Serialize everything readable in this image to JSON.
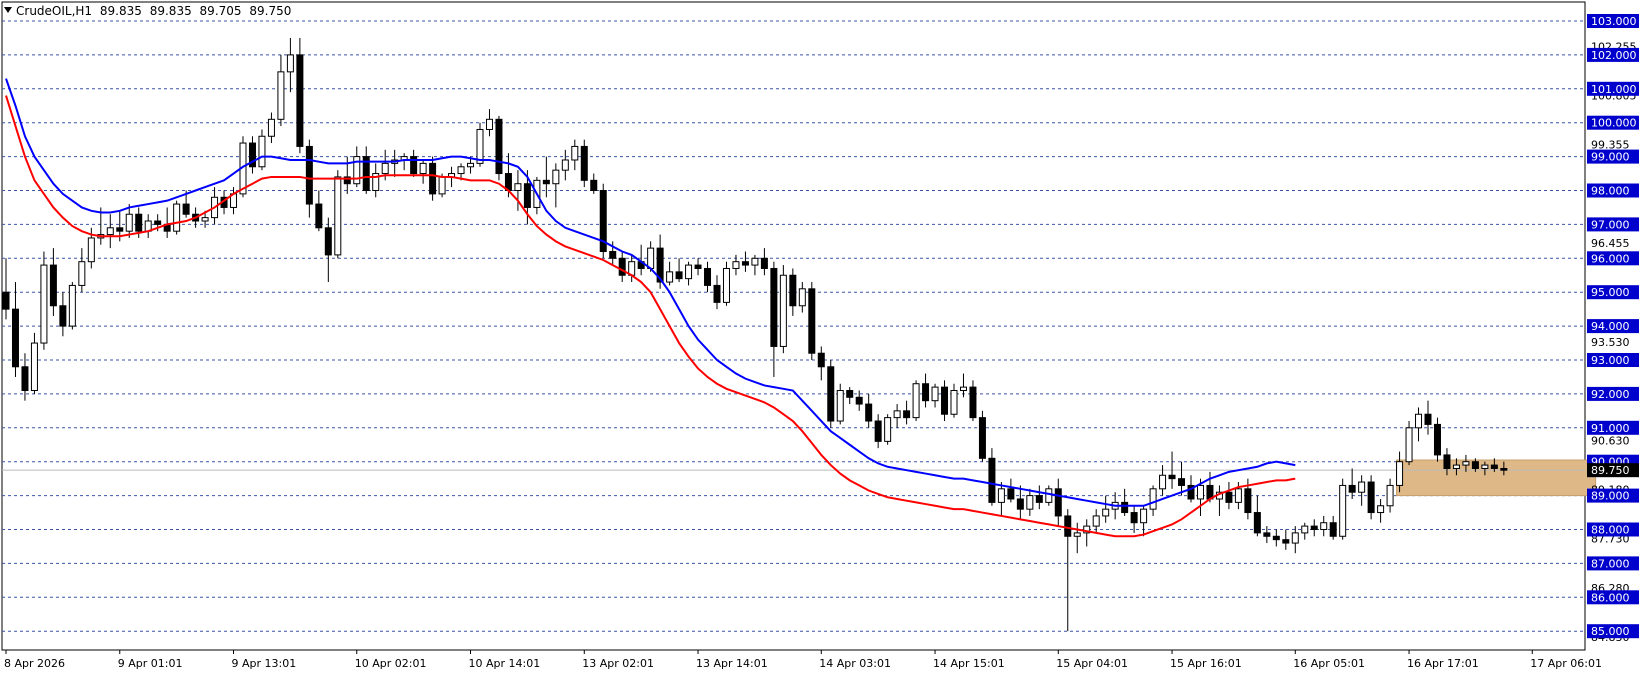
{
  "header": {
    "symbol": "CrudeOIL,H1",
    "open": "89.835",
    "high": "89.835",
    "low": "89.705",
    "close": "89.750"
  },
  "colors": {
    "background": "#ffffff",
    "grid": "#3b55a5",
    "bull_candle": "#ffffff",
    "bear_candle": "#000000",
    "ma_fast": "#0000ff",
    "ma_slow": "#ff0000",
    "zone": "#deb887",
    "highlight_label": "#0000cd",
    "current_price_label": "#000000"
  },
  "chart_data": {
    "type": "candlestick",
    "title": "CrudeOIL,H1",
    "ylim": [
      84.6,
      103.5
    ],
    "grid": true,
    "price_levels": [
      "103.000",
      "102.000",
      "101.000",
      "100.000",
      "99.000",
      "98.000",
      "97.000",
      "96.000",
      "95.000",
      "94.000",
      "93.000",
      "92.000",
      "91.000",
      "90.000",
      "89.000",
      "88.000",
      "87.000",
      "86.000",
      "85.000"
    ],
    "minor_labels": [
      {
        "value": 102.255,
        "text": "102.255"
      },
      {
        "value": 100.805,
        "text": "100.805"
      },
      {
        "value": 99.355,
        "text": "99.355"
      },
      {
        "value": 96.455,
        "text": "96.455"
      },
      {
        "value": 93.53,
        "text": "93.530"
      },
      {
        "value": 90.63,
        "text": "90.630"
      },
      {
        "value": 89.18,
        "text": "89.180"
      },
      {
        "value": 87.73,
        "text": "87.730"
      },
      {
        "value": 86.28,
        "text": "86.280"
      },
      {
        "value": 84.83,
        "text": "84.830"
      }
    ],
    "current_price": {
      "value": 89.75,
      "text": "89.750"
    },
    "x_labels": [
      {
        "index": 0,
        "text": "8 Apr 2026"
      },
      {
        "index": 12,
        "text": "9 Apr 01:01"
      },
      {
        "index": 24,
        "text": "9 Apr 13:01"
      },
      {
        "index": 37,
        "text": "10 Apr 02:01"
      },
      {
        "index": 49,
        "text": "10 Apr 14:01"
      },
      {
        "index": 61,
        "text": "13 Apr 02:01"
      },
      {
        "index": 73,
        "text": "13 Apr 14:01"
      },
      {
        "index": 86,
        "text": "14 Apr 03:01"
      },
      {
        "index": 98,
        "text": "14 Apr 15:01"
      },
      {
        "index": 111,
        "text": "15 Apr 04:01"
      },
      {
        "index": 123,
        "text": "15 Apr 16:01"
      },
      {
        "index": 136,
        "text": "16 Apr 05:01"
      },
      {
        "index": 148,
        "text": "16 Apr 17:01"
      },
      {
        "index": 161,
        "text": "17 Apr 06:01"
      }
    ],
    "zone": {
      "from_index": 147,
      "to_index": 168,
      "high": 90.05,
      "low": 89.0
    },
    "ohlc": [
      [
        95.0,
        96.0,
        94.2,
        94.5
      ],
      [
        94.5,
        95.3,
        92.5,
        92.8
      ],
      [
        92.8,
        93.2,
        91.8,
        92.1
      ],
      [
        92.1,
        93.8,
        92.0,
        93.5
      ],
      [
        93.5,
        96.2,
        93.3,
        95.8
      ],
      [
        95.8,
        96.3,
        94.3,
        94.6
      ],
      [
        94.6,
        95.0,
        93.7,
        94.0
      ],
      [
        94.0,
        95.3,
        93.9,
        95.2
      ],
      [
        95.2,
        96.3,
        95.0,
        95.9
      ],
      [
        95.9,
        96.9,
        95.7,
        96.6
      ],
      [
        96.6,
        97.5,
        96.4,
        96.7
      ],
      [
        96.7,
        97.3,
        96.3,
        96.9
      ],
      [
        96.9,
        97.4,
        96.5,
        96.8
      ],
      [
        96.8,
        97.6,
        96.6,
        97.3
      ],
      [
        97.3,
        97.5,
        96.6,
        96.8
      ],
      [
        96.8,
        97.3,
        96.6,
        97.1
      ],
      [
        97.1,
        97.3,
        96.8,
        97.0
      ],
      [
        97.0,
        97.5,
        96.6,
        96.8
      ],
      [
        96.8,
        97.7,
        96.7,
        97.6
      ],
      [
        97.6,
        98.0,
        97.2,
        97.3
      ],
      [
        97.3,
        97.5,
        96.9,
        97.1
      ],
      [
        97.1,
        97.4,
        96.9,
        97.2
      ],
      [
        97.2,
        98.1,
        97.0,
        97.8
      ],
      [
        97.8,
        98.0,
        97.3,
        97.5
      ],
      [
        97.5,
        98.1,
        97.3,
        97.9
      ],
      [
        97.9,
        99.6,
        97.8,
        99.4
      ],
      [
        99.4,
        99.6,
        98.5,
        98.7
      ],
      [
        98.7,
        99.8,
        98.6,
        99.6
      ],
      [
        99.6,
        100.3,
        99.4,
        100.1
      ],
      [
        100.1,
        102.0,
        99.9,
        101.5
      ],
      [
        101.5,
        102.5,
        100.9,
        102.0
      ],
      [
        102.0,
        102.5,
        99.1,
        99.3
      ],
      [
        99.3,
        99.5,
        97.2,
        97.6
      ],
      [
        97.6,
        98.0,
        96.8,
        96.9
      ],
      [
        96.9,
        97.2,
        95.3,
        96.1
      ],
      [
        96.1,
        98.6,
        96.0,
        98.4
      ],
      [
        98.4,
        99.0,
        97.9,
        98.2
      ],
      [
        98.2,
        99.3,
        98.1,
        99.0
      ],
      [
        99.0,
        99.3,
        97.9,
        98.0
      ],
      [
        98.0,
        98.8,
        97.8,
        98.5
      ],
      [
        98.5,
        99.2,
        98.3,
        98.8
      ],
      [
        98.8,
        99.2,
        98.4,
        98.9
      ],
      [
        98.9,
        99.1,
        98.6,
        99.0
      ],
      [
        99.0,
        99.2,
        98.4,
        98.5
      ],
      [
        98.5,
        98.9,
        98.2,
        98.8
      ],
      [
        98.8,
        99.0,
        97.7,
        97.9
      ],
      [
        97.9,
        98.5,
        97.8,
        98.4
      ],
      [
        98.4,
        98.7,
        98.1,
        98.5
      ],
      [
        98.5,
        98.8,
        98.3,
        98.7
      ],
      [
        98.7,
        99.0,
        98.5,
        98.8
      ],
      [
        98.8,
        100.0,
        98.7,
        99.8
      ],
      [
        99.8,
        100.4,
        99.6,
        100.1
      ],
      [
        100.1,
        100.2,
        98.3,
        98.5
      ],
      [
        98.5,
        99.1,
        97.8,
        98.0
      ],
      [
        98.0,
        98.6,
        97.4,
        98.2
      ],
      [
        98.2,
        98.6,
        97.0,
        97.5
      ],
      [
        97.5,
        98.4,
        97.3,
        98.3
      ],
      [
        98.3,
        99.0,
        97.8,
        98.2
      ],
      [
        98.2,
        98.8,
        97.5,
        98.6
      ],
      [
        98.6,
        99.2,
        98.3,
        98.9
      ],
      [
        98.9,
        99.5,
        98.6,
        99.3
      ],
      [
        99.3,
        99.5,
        98.1,
        98.3
      ],
      [
        98.3,
        98.5,
        97.9,
        98.0
      ],
      [
        98.0,
        98.2,
        96.0,
        96.2
      ],
      [
        96.2,
        96.5,
        95.8,
        96.0
      ],
      [
        96.0,
        96.2,
        95.3,
        95.5
      ],
      [
        95.5,
        96.1,
        95.3,
        95.9
      ],
      [
        95.9,
        96.4,
        95.5,
        95.7
      ],
      [
        95.7,
        96.5,
        95.6,
        96.3
      ],
      [
        96.3,
        96.7,
        95.1,
        95.3
      ],
      [
        95.3,
        95.9,
        95.2,
        95.6
      ],
      [
        95.6,
        96.0,
        95.3,
        95.4
      ],
      [
        95.4,
        95.9,
        95.2,
        95.8
      ],
      [
        95.8,
        96.0,
        95.5,
        95.7
      ],
      [
        95.7,
        95.9,
        95.0,
        95.2
      ],
      [
        95.2,
        95.5,
        94.5,
        94.7
      ],
      [
        94.7,
        95.9,
        94.6,
        95.7
      ],
      [
        95.7,
        96.1,
        95.5,
        95.9
      ],
      [
        95.9,
        96.2,
        95.6,
        95.8
      ],
      [
        95.8,
        96.1,
        95.5,
        96.0
      ],
      [
        96.0,
        96.3,
        95.5,
        95.7
      ],
      [
        95.7,
        95.9,
        92.5,
        93.4
      ],
      [
        93.4,
        95.8,
        93.2,
        95.5
      ],
      [
        95.5,
        95.7,
        94.3,
        94.6
      ],
      [
        94.6,
        95.3,
        94.4,
        95.1
      ],
      [
        95.1,
        95.3,
        93.0,
        93.2
      ],
      [
        93.2,
        93.4,
        92.4,
        92.8
      ],
      [
        92.8,
        93.0,
        91.0,
        91.2
      ],
      [
        91.2,
        92.3,
        91.1,
        92.1
      ],
      [
        92.1,
        92.2,
        91.7,
        91.9
      ],
      [
        91.9,
        92.1,
        91.5,
        91.7
      ],
      [
        91.7,
        92.0,
        91.0,
        91.2
      ],
      [
        91.2,
        91.4,
        90.4,
        90.6
      ],
      [
        90.6,
        91.4,
        90.5,
        91.3
      ],
      [
        91.3,
        91.7,
        91.0,
        91.5
      ],
      [
        91.5,
        91.8,
        91.1,
        91.3
      ],
      [
        91.3,
        92.4,
        91.2,
        92.3
      ],
      [
        92.3,
        92.6,
        91.6,
        91.8
      ],
      [
        91.8,
        92.3,
        91.6,
        92.2
      ],
      [
        92.2,
        92.4,
        91.2,
        91.4
      ],
      [
        91.4,
        92.3,
        91.3,
        92.1
      ],
      [
        92.1,
        92.6,
        91.9,
        92.2
      ],
      [
        92.2,
        92.4,
        91.2,
        91.3
      ],
      [
        91.3,
        91.5,
        90.0,
        90.1
      ],
      [
        90.1,
        90.4,
        88.7,
        88.8
      ],
      [
        88.8,
        89.4,
        88.4,
        89.2
      ],
      [
        89.2,
        89.5,
        88.8,
        88.9
      ],
      [
        88.9,
        89.3,
        88.3,
        88.6
      ],
      [
        88.6,
        89.2,
        88.4,
        89.0
      ],
      [
        89.0,
        89.3,
        88.6,
        88.8
      ],
      [
        88.8,
        89.3,
        88.7,
        89.2
      ],
      [
        89.2,
        89.5,
        88.1,
        88.4
      ],
      [
        88.4,
        88.6,
        85.0,
        87.8
      ],
      [
        87.8,
        88.2,
        87.3,
        87.9
      ],
      [
        87.9,
        88.3,
        87.5,
        88.1
      ],
      [
        88.1,
        88.6,
        87.9,
        88.4
      ],
      [
        88.4,
        89.0,
        88.2,
        88.6
      ],
      [
        88.6,
        89.1,
        88.3,
        88.8
      ],
      [
        88.8,
        89.2,
        88.4,
        88.5
      ],
      [
        88.5,
        88.7,
        87.9,
        88.2
      ],
      [
        88.2,
        88.7,
        87.8,
        88.6
      ],
      [
        88.6,
        89.3,
        88.4,
        89.2
      ],
      [
        89.2,
        89.9,
        89.0,
        89.6
      ],
      [
        89.6,
        90.3,
        89.2,
        89.5
      ],
      [
        89.5,
        90.0,
        89.0,
        89.3
      ],
      [
        89.3,
        89.6,
        88.8,
        88.9
      ],
      [
        88.9,
        89.5,
        88.4,
        89.3
      ],
      [
        89.3,
        89.7,
        88.8,
        88.9
      ],
      [
        88.9,
        89.3,
        88.4,
        89.1
      ],
      [
        89.1,
        89.4,
        88.6,
        88.8
      ],
      [
        88.8,
        89.4,
        88.6,
        89.2
      ],
      [
        89.2,
        89.5,
        88.3,
        88.5
      ],
      [
        88.5,
        89.0,
        87.8,
        87.9
      ],
      [
        87.9,
        88.1,
        87.6,
        87.8
      ],
      [
        87.8,
        88.0,
        87.5,
        87.7
      ],
      [
        87.7,
        88.0,
        87.4,
        87.6
      ],
      [
        87.6,
        88.1,
        87.3,
        87.9
      ],
      [
        87.9,
        88.2,
        87.7,
        88.1
      ],
      [
        88.1,
        88.3,
        87.8,
        88.0
      ],
      [
        88.0,
        88.4,
        87.8,
        88.2
      ],
      [
        88.2,
        88.4,
        87.7,
        87.8
      ],
      [
        87.8,
        89.5,
        87.7,
        89.3
      ],
      [
        89.3,
        89.8,
        88.9,
        89.1
      ],
      [
        89.1,
        89.6,
        88.7,
        89.4
      ],
      [
        89.4,
        89.6,
        88.3,
        88.5
      ],
      [
        88.5,
        88.9,
        88.2,
        88.7
      ],
      [
        88.7,
        89.5,
        88.5,
        89.3
      ],
      [
        89.3,
        90.3,
        89.1,
        90.0
      ],
      [
        90.0,
        91.2,
        89.9,
        91.0
      ],
      [
        91.0,
        91.6,
        90.6,
        91.4
      ],
      [
        91.4,
        91.8,
        90.8,
        91.1
      ],
      [
        91.1,
        91.3,
        90.0,
        90.2
      ],
      [
        90.2,
        90.4,
        89.6,
        89.8
      ],
      [
        89.8,
        90.1,
        89.6,
        89.9
      ],
      [
        89.9,
        90.2,
        89.7,
        90.0
      ],
      [
        90.0,
        90.1,
        89.7,
        89.8
      ],
      [
        89.8,
        90.0,
        89.6,
        89.9
      ],
      [
        89.9,
        90.1,
        89.7,
        89.8
      ],
      [
        89.8,
        90.0,
        89.6,
        89.75
      ]
    ],
    "ma_fast": {
      "name": "",
      "values": [
        101.3,
        100.5,
        99.6,
        99.0,
        98.6,
        98.2,
        97.9,
        97.7,
        97.5,
        97.4,
        97.35,
        97.35,
        97.4,
        97.5,
        97.55,
        97.6,
        97.65,
        97.7,
        97.8,
        97.9,
        98.0,
        98.1,
        98.2,
        98.3,
        98.5,
        98.7,
        98.85,
        99.0,
        99.0,
        98.95,
        98.9,
        98.9,
        98.9,
        98.85,
        98.8,
        98.8,
        98.8,
        98.85,
        98.85,
        98.85,
        98.85,
        98.85,
        98.9,
        98.9,
        98.9,
        98.9,
        98.95,
        99.0,
        99.0,
        98.95,
        98.9,
        98.9,
        98.85,
        98.8,
        98.7,
        98.4,
        97.9,
        97.4,
        97.1,
        96.9,
        96.8,
        96.7,
        96.6,
        96.5,
        96.35,
        96.2,
        96.1,
        95.9,
        95.7,
        95.4,
        95.0,
        94.5,
        94.0,
        93.6,
        93.3,
        93.0,
        92.8,
        92.6,
        92.45,
        92.35,
        92.25,
        92.2,
        92.15,
        92.1,
        91.8,
        91.5,
        91.2,
        90.9,
        90.7,
        90.5,
        90.3,
        90.1,
        89.95,
        89.85,
        89.8,
        89.75,
        89.7,
        89.65,
        89.6,
        89.55,
        89.5,
        89.5,
        89.45,
        89.4,
        89.35,
        89.3,
        89.25,
        89.2,
        89.15,
        89.1,
        89.05,
        89.0,
        88.95,
        88.9,
        88.85,
        88.8,
        88.75,
        88.7,
        88.7,
        88.7,
        88.7,
        88.8,
        88.9,
        89.0,
        89.1,
        89.2,
        89.35,
        89.5,
        89.6,
        89.7,
        89.75,
        89.8,
        89.85,
        89.95,
        90.0,
        89.95,
        89.9
      ]
    },
    "ma_slow": {
      "name": "",
      "values": [
        100.8,
        99.9,
        99.0,
        98.3,
        97.9,
        97.5,
        97.2,
        96.95,
        96.8,
        96.7,
        96.65,
        96.65,
        96.65,
        96.7,
        96.75,
        96.8,
        96.9,
        97.0,
        97.05,
        97.1,
        97.2,
        97.35,
        97.5,
        97.7,
        97.9,
        98.05,
        98.2,
        98.35,
        98.4,
        98.4,
        98.4,
        98.4,
        98.35,
        98.35,
        98.35,
        98.35,
        98.35,
        98.35,
        98.4,
        98.4,
        98.45,
        98.45,
        98.45,
        98.45,
        98.45,
        98.45,
        98.4,
        98.4,
        98.35,
        98.3,
        98.3,
        98.3,
        98.2,
        98.0,
        97.7,
        97.3,
        96.95,
        96.7,
        96.5,
        96.35,
        96.25,
        96.15,
        96.05,
        95.95,
        95.8,
        95.65,
        95.5,
        95.3,
        95.0,
        94.5,
        94.0,
        93.5,
        93.1,
        92.75,
        92.5,
        92.3,
        92.15,
        92.05,
        91.95,
        91.85,
        91.75,
        91.6,
        91.4,
        91.2,
        90.9,
        90.55,
        90.2,
        89.9,
        89.65,
        89.45,
        89.3,
        89.15,
        89.05,
        88.95,
        88.9,
        88.85,
        88.8,
        88.75,
        88.7,
        88.65,
        88.6,
        88.6,
        88.55,
        88.5,
        88.45,
        88.4,
        88.35,
        88.3,
        88.25,
        88.2,
        88.15,
        88.1,
        88.05,
        88.0,
        87.95,
        87.9,
        87.85,
        87.8,
        87.8,
        87.8,
        87.85,
        87.95,
        88.05,
        88.15,
        88.3,
        88.5,
        88.7,
        88.9,
        89.05,
        89.15,
        89.25,
        89.3,
        89.35,
        89.4,
        89.45,
        89.45,
        89.5
      ]
    }
  }
}
